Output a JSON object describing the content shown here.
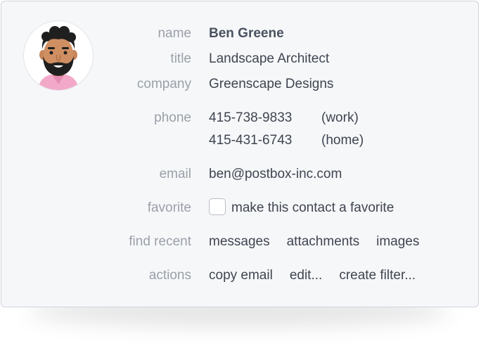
{
  "contact": {
    "avatar_icon": "bearded-man-avatar",
    "name_label": "name",
    "name": "Ben Greene",
    "title_label": "title",
    "title": "Landscape Architect",
    "company_label": "company",
    "company": "Greenscape Designs",
    "phone_label": "phone",
    "phones": [
      {
        "number": "415-738-9833",
        "type": "(work)"
      },
      {
        "number": "415-431-6743",
        "type": "(home)"
      }
    ],
    "email_label": "email",
    "email": "ben@postbox-inc.com",
    "favorite_label": "favorite",
    "favorite_text": "make this contact a favorite",
    "favorite_checked": false,
    "find_recent_label": "find recent",
    "find_recent": [
      "messages",
      "attachments",
      "images"
    ],
    "actions_label": "actions",
    "actions": [
      "copy email",
      "edit...",
      "create filter..."
    ]
  },
  "colors": {
    "card_background": "#f6f7f9",
    "label_text": "#9aa0a8",
    "value_text": "#3f4550",
    "border": "#cfd3da"
  }
}
